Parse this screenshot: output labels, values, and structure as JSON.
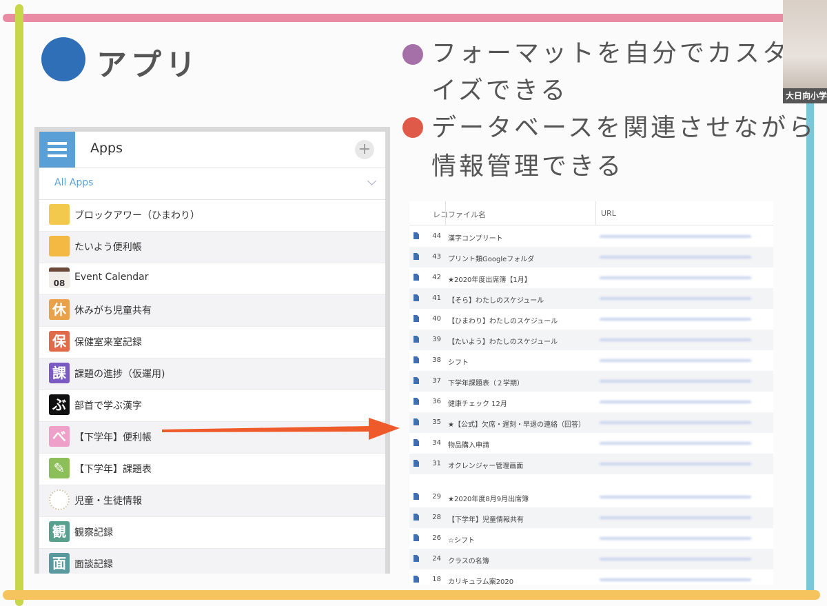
{
  "title": "アプリ",
  "bullets": [
    {
      "lines": [
        "フォーマットを自分でカスタマ",
        "イズできる"
      ],
      "color": "#a56fa8"
    },
    {
      "lines": [
        "データベースを関連させながら",
        "情報管理できる"
      ],
      "color": "#e05a4a"
    }
  ],
  "webcam": {
    "label": "大日向小学"
  },
  "apps_panel": {
    "title": "Apps",
    "add_label": "+",
    "filter_label": "All Apps",
    "apps": [
      {
        "label": "ブロックアワー（ひまわり）",
        "icon": "diamond-icon",
        "icon_text": "",
        "color": "#f2c94c"
      },
      {
        "label": "たいよう便利帳",
        "icon": "sun-icon",
        "icon_text": "",
        "color": "#f4b942"
      },
      {
        "label": "Event Calendar",
        "icon": "calendar-icon",
        "icon_text": "08",
        "color": "#6b4a3a"
      },
      {
        "label": "休みがち児童共有",
        "icon": "kanji-icon",
        "icon_text": "休",
        "color": "#e9a24a"
      },
      {
        "label": "保健室来室記録",
        "icon": "kanji-icon",
        "icon_text": "保",
        "color": "#e06a4a"
      },
      {
        "label": "課題の進捗（仮運用)",
        "icon": "kanji-icon",
        "icon_text": "課",
        "color": "#7a5bc4"
      },
      {
        "label": "部首で学ぶ漢字",
        "icon": "kanji-icon",
        "icon_text": "ぶ",
        "color": "#111111"
      },
      {
        "label": "【下学年】便利帳",
        "icon": "kana-icon",
        "icon_text": "べ",
        "color": "#eea0c8"
      },
      {
        "label": "【下学年】課題表",
        "icon": "pencil-icon",
        "icon_text": "✎",
        "color": "#8cbf5a"
      },
      {
        "label": "児童・生徒情報",
        "icon": "dotted-circle-icon",
        "icon_text": "",
        "color": "#d8c8b0"
      },
      {
        "label": "観察記録",
        "icon": "kanji-icon",
        "icon_text": "観",
        "color": "#5aa08e"
      },
      {
        "label": "面談記録",
        "icon": "kanji-icon",
        "icon_text": "面",
        "color": "#5a9a9e"
      }
    ]
  },
  "table": {
    "headers": {
      "num": "レコ",
      "name": "ファイル名",
      "url": "URL"
    },
    "rows": [
      {
        "num": "44",
        "name": "漢字コンプリート"
      },
      {
        "num": "43",
        "name": "プリント類Googleフォルダ"
      },
      {
        "num": "42",
        "name": "★2020年度出席簿【1月】"
      },
      {
        "num": "41",
        "name": "【そら】わたしのスケジュール"
      },
      {
        "num": "40",
        "name": "【ひまわり】わたしのスケジュール"
      },
      {
        "num": "39",
        "name": "【たいよう】わたしのスケジュール"
      },
      {
        "num": "38",
        "name": "シフト"
      },
      {
        "num": "37",
        "name": "下学年課題表（２学期）"
      },
      {
        "num": "36",
        "name": "健康チェック 12月"
      },
      {
        "num": "35",
        "name": "★【公式】欠席・遅刻・早退の連絡（回答）"
      },
      {
        "num": "34",
        "name": "物品購入申請"
      },
      {
        "num": "31",
        "name": "オクレンジャー管理画面"
      },
      {
        "num": "29",
        "name": "★2020年度8月9月出席簿"
      },
      {
        "num": "28",
        "name": "【下学年】児童情報共有"
      },
      {
        "num": "26",
        "name": "☆シフト"
      },
      {
        "num": "24",
        "name": "クラスの名簿"
      },
      {
        "num": "18",
        "name": "カリキュラム案2020"
      }
    ]
  }
}
